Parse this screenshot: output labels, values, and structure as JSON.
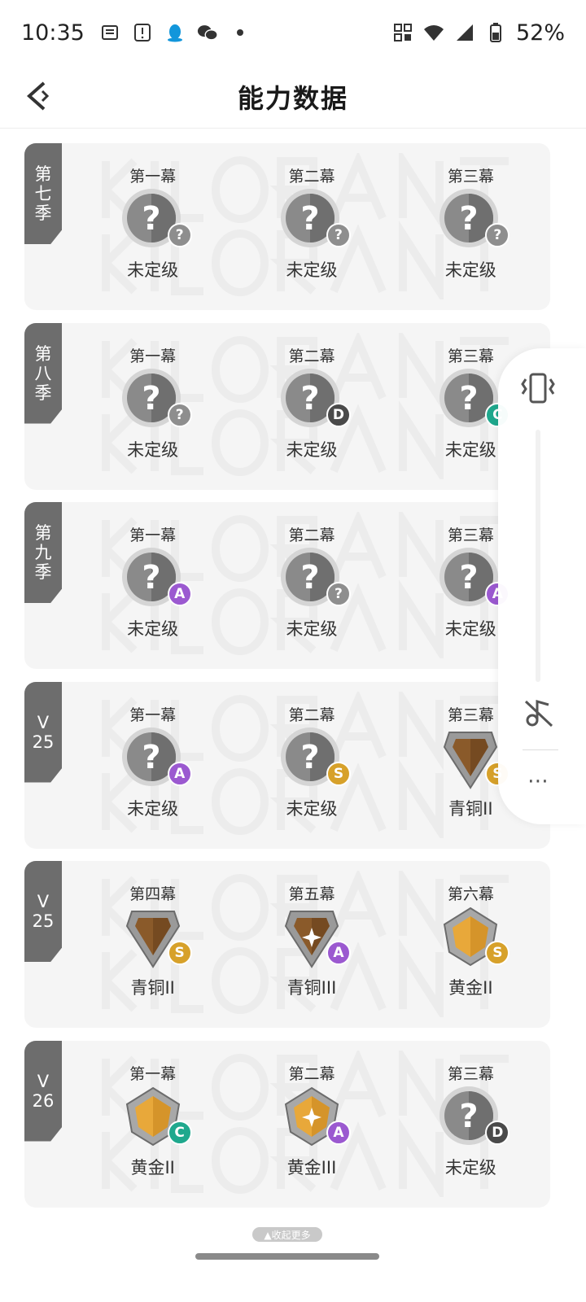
{
  "status_bar": {
    "time": "10:35",
    "battery": "52%",
    "left_icons": [
      "news-icon",
      "alert-card-icon",
      "qq-icon",
      "wechat-icon",
      "dot-icon"
    ],
    "right_icons": [
      "nfc-icon",
      "wifi-icon",
      "signal-icon",
      "battery-icon"
    ]
  },
  "header": {
    "title": "能力数据",
    "back_icon": "back-chevron-icon"
  },
  "colors": {
    "card_bg": "#f5f5f5",
    "tag_bg": "#6d6d6d",
    "badge_A": "#9b59d0",
    "badge_S": "#d7a12a",
    "badge_C": "#1fa88d",
    "badge_D": "#4a4a4a",
    "badge_unknown": "#8e8e8e"
  },
  "seasons": [
    {
      "tag": "第七季",
      "acts": [
        {
          "name": "第一幕",
          "rank": "未定级",
          "emblem": "unrated",
          "badge": "?"
        },
        {
          "name": "第二幕",
          "rank": "未定级",
          "emblem": "unrated",
          "badge": "?"
        },
        {
          "name": "第三幕",
          "rank": "未定级",
          "emblem": "unrated",
          "badge": "?"
        }
      ]
    },
    {
      "tag": "第八季",
      "acts": [
        {
          "name": "第一幕",
          "rank": "未定级",
          "emblem": "unrated",
          "badge": "?"
        },
        {
          "name": "第二幕",
          "rank": "未定级",
          "emblem": "unrated",
          "badge": "D"
        },
        {
          "name": "第三幕",
          "rank": "未定级",
          "emblem": "unrated",
          "badge": "C"
        }
      ]
    },
    {
      "tag": "第九季",
      "acts": [
        {
          "name": "第一幕",
          "rank": "未定级",
          "emblem": "unrated",
          "badge": "A"
        },
        {
          "name": "第二幕",
          "rank": "未定级",
          "emblem": "unrated",
          "badge": "?"
        },
        {
          "name": "第三幕",
          "rank": "未定级",
          "emblem": "unrated",
          "badge": "A"
        }
      ]
    },
    {
      "tag": "V\n25",
      "acts": [
        {
          "name": "第一幕",
          "rank": "未定级",
          "emblem": "unrated",
          "badge": "A"
        },
        {
          "name": "第二幕",
          "rank": "未定级",
          "emblem": "unrated",
          "badge": "S"
        },
        {
          "name": "第三幕",
          "rank": "青铜II",
          "emblem": "bronze",
          "badge": "S"
        }
      ]
    },
    {
      "tag": "V\n25",
      "acts": [
        {
          "name": "第四幕",
          "rank": "青铜II",
          "emblem": "bronze",
          "badge": "S"
        },
        {
          "name": "第五幕",
          "rank": "青铜III",
          "emblem": "bronze3",
          "badge": "A"
        },
        {
          "name": "第六幕",
          "rank": "黄金II",
          "emblem": "gold",
          "badge": "S"
        }
      ]
    },
    {
      "tag": "V\n26",
      "acts": [
        {
          "name": "第一幕",
          "rank": "黄金II",
          "emblem": "gold",
          "badge": "C"
        },
        {
          "name": "第二幕",
          "rank": "黄金III",
          "emblem": "gold3",
          "badge": "A"
        },
        {
          "name": "第三幕",
          "rank": "未定级",
          "emblem": "unrated",
          "badge": "D"
        }
      ]
    }
  ],
  "footer": {
    "collapse_label": "▲收起更多"
  },
  "floating_panel": {
    "icons": [
      "vibrate-icon",
      "mute-icon",
      "more-icon"
    ],
    "more_label": "⋯"
  }
}
